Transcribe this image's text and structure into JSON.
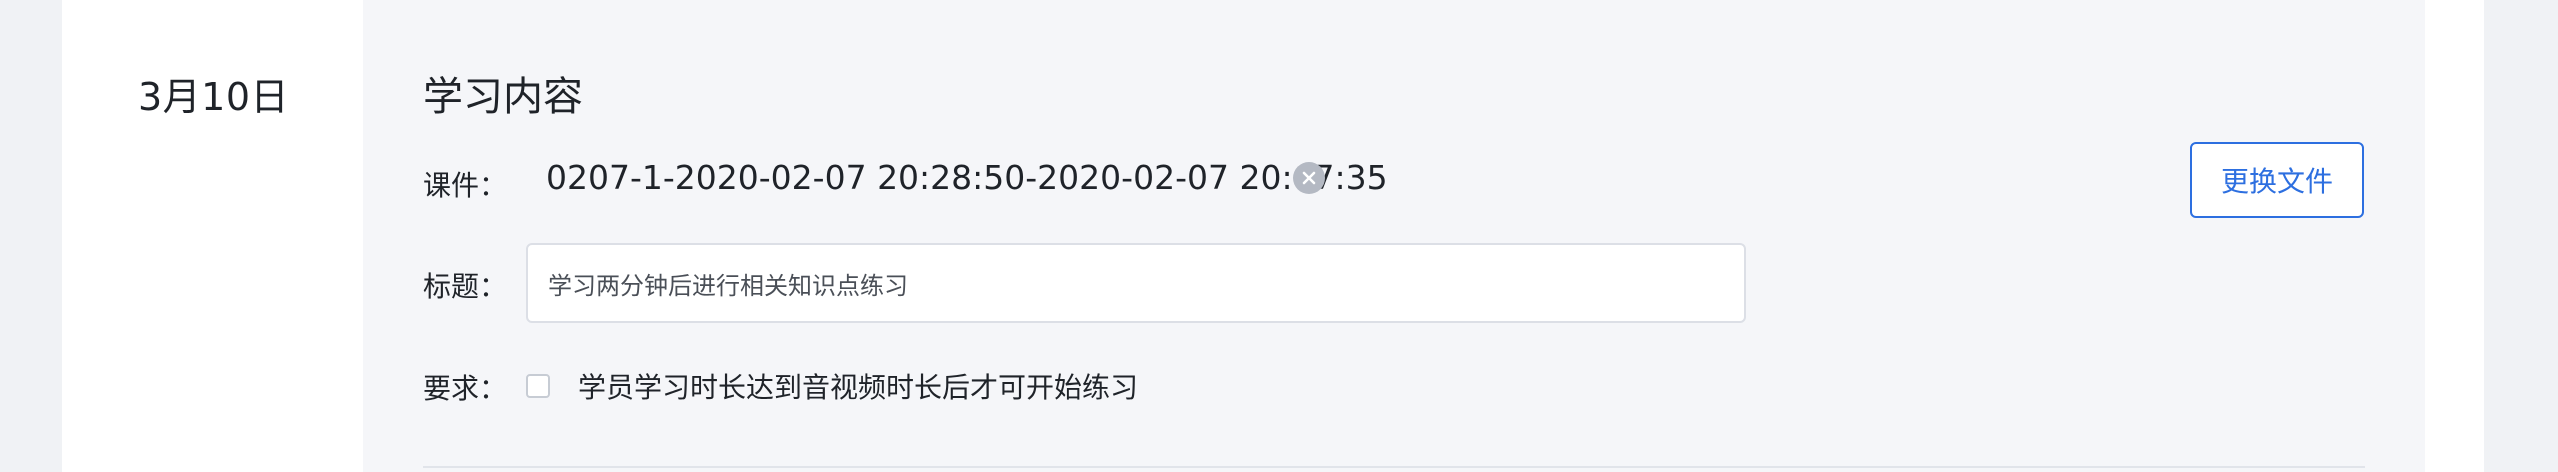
{
  "date_column": {
    "date": "3月10日"
  },
  "section": {
    "title": "学习内容"
  },
  "courseware": {
    "label": "课件：",
    "file_name": "0207-1-2020-02-07 20:28:50-2020-02-07 20:47:35",
    "remove_icon": "close-circle-icon",
    "replace_button": "更换文件"
  },
  "title_field": {
    "label": "标题：",
    "value": "学习两分钟后进行相关知识点练习"
  },
  "requirement": {
    "label": "要求：",
    "checkbox_checked": false,
    "checkbox_label": "学员学习时长达到音视频时长后才可开始练习"
  },
  "colors": {
    "accent": "#2d6fe0",
    "panel_background": "#f5f6f9",
    "page_background": "#f0f2f5"
  }
}
